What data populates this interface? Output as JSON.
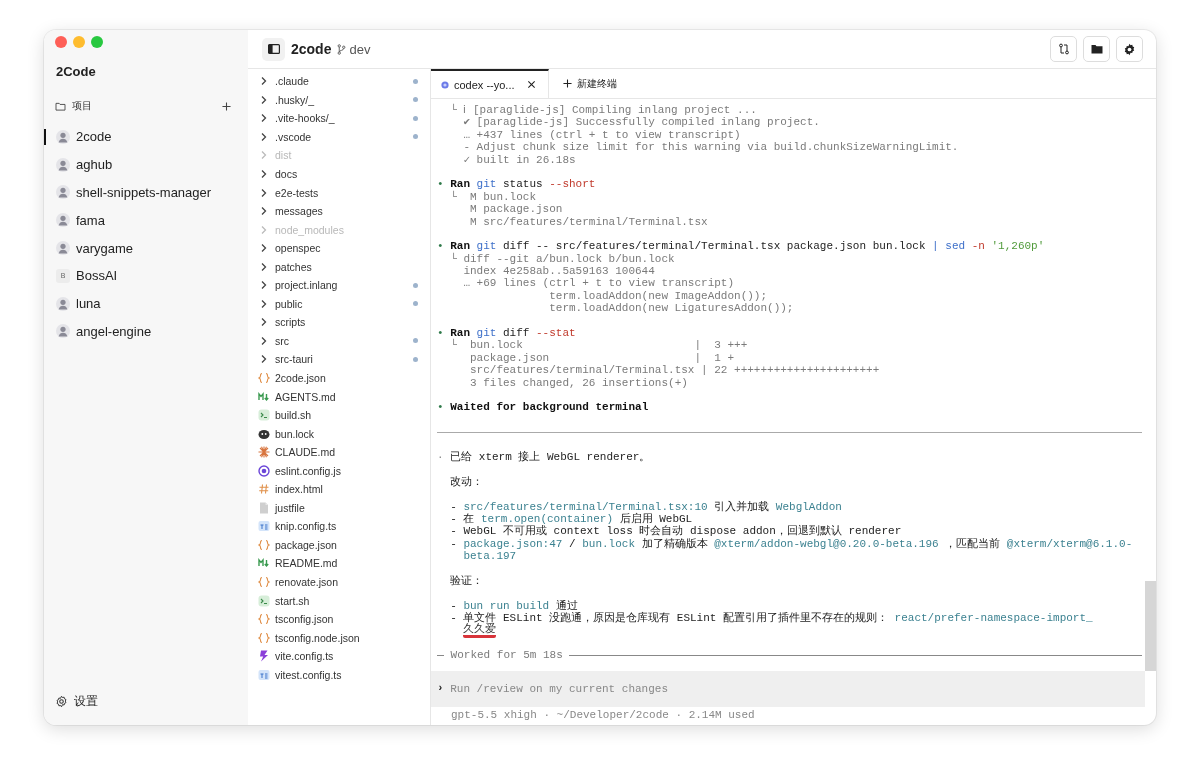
{
  "window": {
    "app_name": "2Code"
  },
  "sidebar": {
    "section": {
      "label": "项目"
    },
    "projects": [
      {
        "name": "2code",
        "kind": "picture",
        "selected": true
      },
      {
        "name": "aghub",
        "kind": "picture",
        "selected": false
      },
      {
        "name": "shell-snippets-manager",
        "kind": "picture",
        "selected": false
      },
      {
        "name": "fama",
        "kind": "picture",
        "selected": false
      },
      {
        "name": "varygame",
        "kind": "picture",
        "selected": false
      },
      {
        "name": "BossAI",
        "kind": "letter",
        "letter": "B",
        "selected": false
      },
      {
        "name": "luna",
        "kind": "picture",
        "selected": false
      },
      {
        "name": "angel-engine",
        "kind": "picture",
        "selected": false
      }
    ],
    "settings": {
      "label": "设置"
    }
  },
  "toolbar": {
    "project": "2code",
    "branch": "dev"
  },
  "file_tree": [
    {
      "name": ".claude",
      "kind": "folder",
      "dimmed": false,
      "modified": true
    },
    {
      "name": ".husky/_",
      "kind": "folder",
      "dimmed": false,
      "modified": true
    },
    {
      "name": ".vite-hooks/_",
      "kind": "folder",
      "dimmed": false,
      "modified": true
    },
    {
      "name": ".vscode",
      "kind": "folder",
      "dimmed": false,
      "modified": true
    },
    {
      "name": "dist",
      "kind": "folder",
      "dimmed": true,
      "modified": false
    },
    {
      "name": "docs",
      "kind": "folder",
      "dimmed": false,
      "modified": false
    },
    {
      "name": "e2e-tests",
      "kind": "folder",
      "dimmed": false,
      "modified": false
    },
    {
      "name": "messages",
      "kind": "folder",
      "dimmed": false,
      "modified": false
    },
    {
      "name": "node_modules",
      "kind": "folder",
      "dimmed": true,
      "modified": false
    },
    {
      "name": "openspec",
      "kind": "folder",
      "dimmed": false,
      "modified": false
    },
    {
      "name": "patches",
      "kind": "folder",
      "dimmed": false,
      "modified": false
    },
    {
      "name": "project.inlang",
      "kind": "folder",
      "dimmed": false,
      "modified": true
    },
    {
      "name": "public",
      "kind": "folder",
      "dimmed": false,
      "modified": true
    },
    {
      "name": "scripts",
      "kind": "folder",
      "dimmed": false,
      "modified": false
    },
    {
      "name": "src",
      "kind": "folder",
      "dimmed": false,
      "modified": true
    },
    {
      "name": "src-tauri",
      "kind": "folder",
      "dimmed": false,
      "modified": true
    },
    {
      "name": "2code.json",
      "kind": "json",
      "dimmed": false,
      "modified": false
    },
    {
      "name": "AGENTS.md",
      "kind": "md",
      "dimmed": false,
      "modified": false
    },
    {
      "name": "build.sh",
      "kind": "sh",
      "dimmed": false,
      "modified": false
    },
    {
      "name": "bun.lock",
      "kind": "lock",
      "dimmed": false,
      "modified": false
    },
    {
      "name": "CLAUDE.md",
      "kind": "claude",
      "dimmed": false,
      "modified": false
    },
    {
      "name": "eslint.config.js",
      "kind": "eslint",
      "dimmed": false,
      "modified": false
    },
    {
      "name": "index.html",
      "kind": "html",
      "dimmed": false,
      "modified": false
    },
    {
      "name": "justfile",
      "kind": "file",
      "dimmed": false,
      "modified": false
    },
    {
      "name": "knip.config.ts",
      "kind": "ts",
      "dimmed": false,
      "modified": false
    },
    {
      "name": "package.json",
      "kind": "json",
      "dimmed": false,
      "modified": false
    },
    {
      "name": "README.md",
      "kind": "md",
      "dimmed": false,
      "modified": false
    },
    {
      "name": "renovate.json",
      "kind": "json",
      "dimmed": false,
      "modified": false
    },
    {
      "name": "start.sh",
      "kind": "sh",
      "dimmed": false,
      "modified": false
    },
    {
      "name": "tsconfig.json",
      "kind": "json",
      "dimmed": false,
      "modified": false
    },
    {
      "name": "tsconfig.node.json",
      "kind": "json",
      "dimmed": false,
      "modified": false
    },
    {
      "name": "vite.config.ts",
      "kind": "vite",
      "dimmed": false,
      "modified": false
    },
    {
      "name": "vitest.config.ts",
      "kind": "ts",
      "dimmed": false,
      "modified": false
    }
  ],
  "terminal_tabs": [
    {
      "label": "codex --yo...",
      "selected": true
    }
  ],
  "new_terminal": {
    "label": "新建终端"
  },
  "terminal_lines": [
    {
      "kind": "branch",
      "parts": [
        {
          "kind": "dim",
          "text": "└ ℹ [paraglide-js] Compiling inlang project ..."
        }
      ]
    },
    {
      "kind": "out",
      "parts": [
        {
          "kind": "dim",
          "text": "✔ [paraglide-js] Successfully compiled inlang project."
        }
      ]
    },
    {
      "kind": "out",
      "parts": [
        {
          "kind": "dim",
          "text": "… +437 lines (ctrl + t to view transcript)"
        }
      ]
    },
    {
      "kind": "out",
      "parts": [
        {
          "kind": "dim",
          "text": "- Adjust chunk size limit for this warning via build.chunkSizeWarningLimit."
        }
      ]
    },
    {
      "kind": "out",
      "parts": [
        {
          "kind": "dim",
          "text": "✓ built in 26.18s"
        }
      ]
    },
    {
      "kind": "gap"
    },
    {
      "kind": "top",
      "parts": [
        {
          "kind": "bullet",
          "text": "•"
        },
        {
          "kind": "bold",
          "text": "Ran"
        },
        {
          "kind": "cmd",
          "text": "git"
        },
        {
          "kind": "plain",
          "text": "status"
        },
        {
          "kind": "flag",
          "text": "--short"
        }
      ]
    },
    {
      "kind": "branch",
      "parts": [
        {
          "kind": "dim",
          "text": "└  M bun.lock"
        }
      ]
    },
    {
      "kind": "out5",
      "parts": [
        {
          "kind": "dim",
          "text": "M package.json"
        }
      ]
    },
    {
      "kind": "out5",
      "parts": [
        {
          "kind": "dim",
          "text": "M src/features/terminal/Terminal.tsx"
        }
      ]
    },
    {
      "kind": "gap"
    },
    {
      "kind": "top",
      "parts": [
        {
          "kind": "bullet",
          "text": "•"
        },
        {
          "kind": "bold",
          "text": "Ran"
        },
        {
          "kind": "cmd",
          "text": "git"
        },
        {
          "kind": "plain",
          "text": "diff -- src/features/terminal/Terminal.tsx package.json bun.lock"
        },
        {
          "kind": "cmd",
          "text": "| sed"
        },
        {
          "kind": "flag",
          "text": "-n"
        },
        {
          "kind": "str",
          "text": "'1,260p'"
        }
      ]
    },
    {
      "kind": "branch",
      "parts": [
        {
          "kind": "dim",
          "text": "└ diff --git a/bun.lock b/bun.lock"
        }
      ]
    },
    {
      "kind": "out",
      "parts": [
        {
          "kind": "dim",
          "text": "index 4e258ab..5a59163 100644"
        }
      ]
    },
    {
      "kind": "out",
      "parts": [
        {
          "kind": "dim",
          "text": "… +69 lines (ctrl + t to view transcript)"
        }
      ]
    },
    {
      "kind": "code",
      "parts": [
        {
          "kind": "dim",
          "text": "term.loadAddon(new ImageAddon());"
        }
      ]
    },
    {
      "kind": "code",
      "parts": [
        {
          "kind": "dim",
          "text": "term.loadAddon(new LigaturesAddon());"
        }
      ]
    },
    {
      "kind": "gap"
    },
    {
      "kind": "top",
      "parts": [
        {
          "kind": "bullet",
          "text": "•"
        },
        {
          "kind": "bold",
          "text": "Ran"
        },
        {
          "kind": "cmd",
          "text": "git"
        },
        {
          "kind": "plain",
          "text": "diff"
        },
        {
          "kind": "flag",
          "text": "--stat"
        }
      ]
    },
    {
      "kind": "branch",
      "parts": [
        {
          "kind": "dim",
          "text": "└  bun.lock                          |  3 +++"
        }
      ]
    },
    {
      "kind": "out5",
      "parts": [
        {
          "kind": "dim",
          "text": "package.json                      |  1 +"
        }
      ]
    },
    {
      "kind": "out5",
      "parts": [
        {
          "kind": "dim",
          "text": "src/features/terminal/Terminal.tsx | 22 ++++++++++++++++++++++"
        }
      ]
    },
    {
      "kind": "out5",
      "parts": [
        {
          "kind": "dim",
          "text": "3 files changed, 26 insertions(+)"
        }
      ]
    },
    {
      "kind": "gap"
    },
    {
      "kind": "top",
      "parts": [
        {
          "kind": "bullet",
          "text": "•"
        },
        {
          "kind": "bold",
          "text": "Waited for background terminal"
        }
      ]
    },
    {
      "kind": "gap"
    },
    {
      "kind": "rule"
    },
    {
      "kind": "gap"
    },
    {
      "kind": "top",
      "parts": [
        {
          "kind": "dot",
          "text": "·"
        },
        {
          "kind": "plain",
          "text": "已给 xterm 接上 WebGL renderer。"
        }
      ]
    },
    {
      "kind": "gap"
    },
    {
      "kind": "reply",
      "parts": [
        {
          "kind": "plain",
          "text": "改动："
        }
      ]
    },
    {
      "kind": "gap"
    },
    {
      "kind": "reply",
      "parts": [
        {
          "kind": "plain",
          "text": "-"
        },
        {
          "kind": "link",
          "text": "src/features/terminal/Terminal.tsx:10"
        },
        {
          "kind": "plain",
          "text": "引入并加载"
        },
        {
          "kind": "link",
          "text": "WebglAddon"
        }
      ]
    },
    {
      "kind": "reply",
      "parts": [
        {
          "kind": "plain",
          "text": "- 在"
        },
        {
          "kind": "link",
          "text": "term.open(container)"
        },
        {
          "kind": "plain",
          "text": "后启用 WebGL"
        }
      ]
    },
    {
      "kind": "reply",
      "parts": [
        {
          "kind": "plain",
          "text": "- WebGL 不可用或 context loss 时会自动 dispose addon，回退到默认 renderer"
        }
      ]
    },
    {
      "kind": "reply",
      "parts": [
        {
          "kind": "plain",
          "text": "-"
        },
        {
          "kind": "link",
          "text": "package.json:47"
        },
        {
          "kind": "plain",
          "text": "/"
        },
        {
          "kind": "link",
          "text": "bun.lock"
        },
        {
          "kind": "plain",
          "text": "加了精确版本"
        },
        {
          "kind": "link",
          "text": "@xterm/addon-webgl@0.20.0-beta.196"
        },
        {
          "kind": "plain",
          "text": "，匹配当前"
        },
        {
          "kind": "link",
          "text": "@xterm/xterm@6.1.0-"
        }
      ]
    },
    {
      "kind": "out",
      "parts": [
        {
          "kind": "link",
          "text": "beta.197"
        }
      ]
    },
    {
      "kind": "gap"
    },
    {
      "kind": "reply",
      "parts": [
        {
          "kind": "plain",
          "text": "验证："
        }
      ]
    },
    {
      "kind": "gap"
    },
    {
      "kind": "reply",
      "parts": [
        {
          "kind": "plain",
          "text": "-"
        },
        {
          "kind": "link",
          "text": "bun run build"
        },
        {
          "kind": "plain",
          "text": "通过"
        }
      ]
    },
    {
      "kind": "reply",
      "parts": [
        {
          "kind": "plain",
          "text": "- 单文件 ESLint 没跑通，原因是仓库现有 ESLint 配置引用了插件里不存在的规则："
        },
        {
          "kind": "link",
          "text": "react/prefer-namespace-import_"
        }
      ]
    },
    {
      "kind": "out",
      "parts": [
        {
          "kind": "ime",
          "text": "久久爱"
        }
      ]
    },
    {
      "kind": "gap"
    },
    {
      "kind": "worked",
      "parts": [
        {
          "kind": "dim",
          "text": "Worked for 5m 18s"
        }
      ]
    }
  ],
  "composer": {
    "prompt": "›",
    "placeholder": "Run /review on my current changes"
  },
  "status_line": "gpt-5.5 xhigh · ~/Developer/2code · 2.14M used"
}
